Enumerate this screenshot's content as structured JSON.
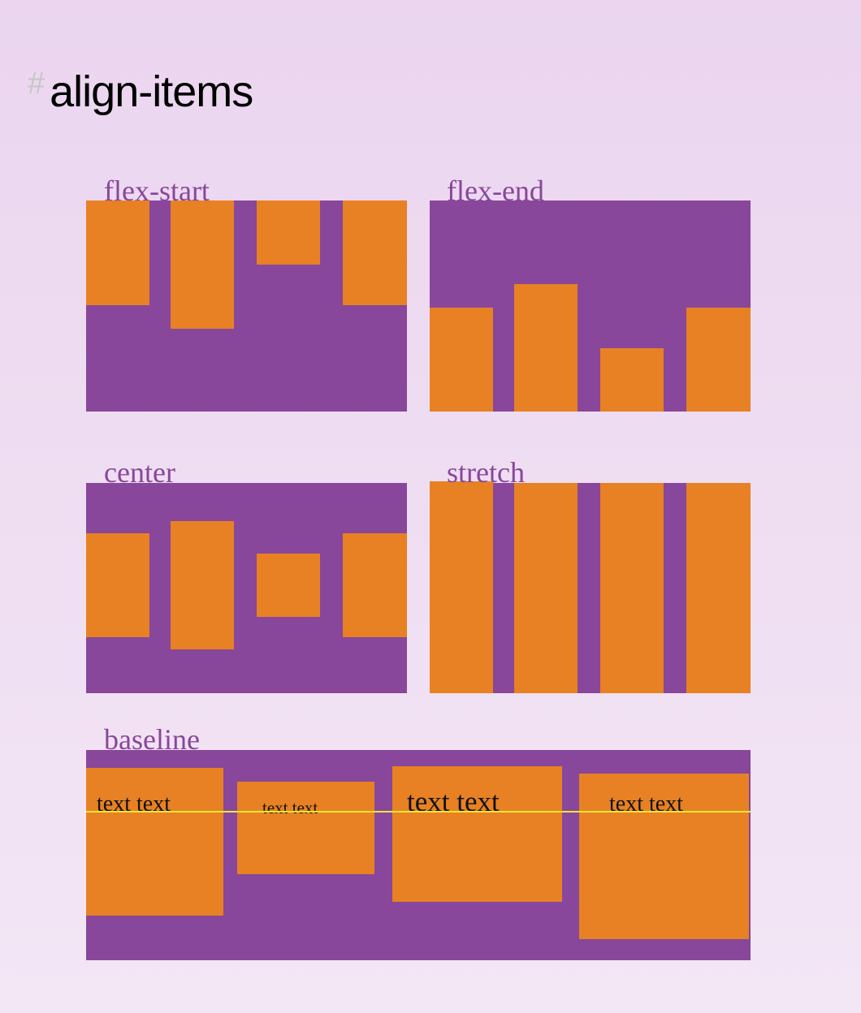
{
  "heading": {
    "hash": "#",
    "title": "align-items"
  },
  "colors": {
    "container": "#88479a",
    "item": "#e78124",
    "baseline": "#f1e82e",
    "label": "#88479a"
  },
  "panels": {
    "flex_start": {
      "label": "flex-start"
    },
    "flex_end": {
      "label": "flex-end"
    },
    "center": {
      "label": "center"
    },
    "stretch": {
      "label": "stretch"
    },
    "baseline": {
      "label": "baseline",
      "items": [
        "text text",
        "text text",
        "text text",
        "text text"
      ]
    }
  }
}
